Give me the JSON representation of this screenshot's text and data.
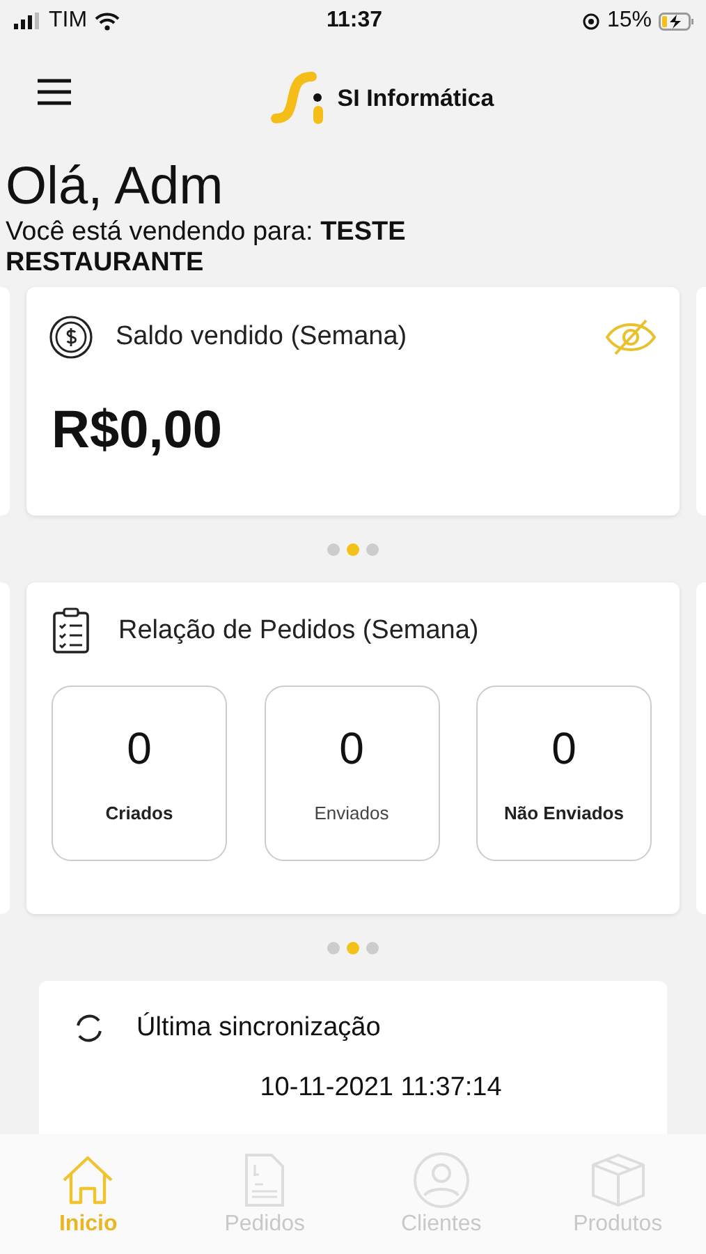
{
  "status_bar": {
    "carrier": "TIM",
    "time": "11:37",
    "battery": "15%"
  },
  "header": {
    "brand": "SI Informática"
  },
  "greeting": {
    "title": "Olá, Adm",
    "selling_to_label": "Você está vendendo para:",
    "customer": "TESTE RESTAURANTE"
  },
  "balance_card": {
    "title": "Saldo vendido (Semana)",
    "amount": "R$0,00"
  },
  "balance_dots": [
    {
      "selected": false
    },
    {
      "selected": true
    },
    {
      "selected": false
    }
  ],
  "orders_card": {
    "title": "Relação de Pedidos (Semana)",
    "stats": [
      {
        "value": "0",
        "label": "Criados",
        "bold": true
      },
      {
        "value": "0",
        "label": "Enviados",
        "bold": false
      },
      {
        "value": "0",
        "label": "Não Enviados",
        "bold": true
      }
    ]
  },
  "orders_dots": [
    {
      "selected": false
    },
    {
      "selected": true
    },
    {
      "selected": false
    }
  ],
  "sync_card": {
    "title": "Última sincronização",
    "timestamp": "10-11-2021  11:37:14"
  },
  "tab_bar": [
    {
      "kind": "home",
      "label": "Inicio",
      "selected": true
    },
    {
      "kind": "orders",
      "label": "Pedidos",
      "selected": false
    },
    {
      "kind": "clients",
      "label": "Clientes",
      "selected": false
    },
    {
      "kind": "products",
      "label": "Produtos",
      "selected": false
    }
  ]
}
